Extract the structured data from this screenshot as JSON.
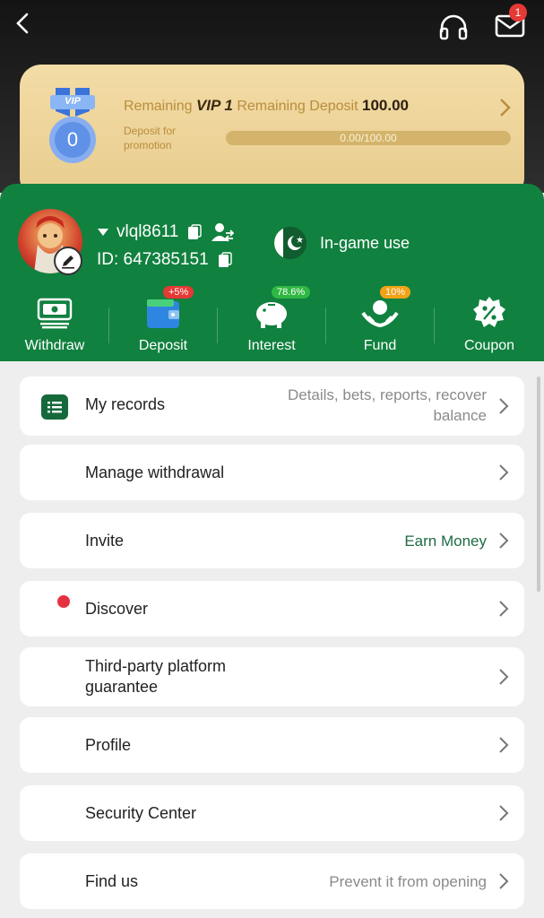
{
  "header": {
    "back_icon": "chevron-left-icon",
    "support_icon": "headset-icon",
    "mail_icon": "envelope-icon",
    "mail_badge": "1"
  },
  "vip": {
    "medal_label": "VIP",
    "medal_level": "0",
    "remaining_label": "Remaining",
    "level": "VIP 1",
    "remaining_deposit_label": "Remaining Deposit",
    "remaining_amount": "100.00",
    "promo_text": "Deposit for promotion",
    "progress_text": "0.00/100.00",
    "progress_fraction": 0.0
  },
  "user": {
    "username": "vlql8611",
    "id_text": "ID: 647385151",
    "status_text": "In-game use"
  },
  "actions": [
    {
      "label": "Withdraw",
      "icon": "cash-icon"
    },
    {
      "label": "Deposit",
      "icon": "wallet-icon",
      "badge": "+5%"
    },
    {
      "label": "Interest",
      "icon": "piggy-bank-icon",
      "badge": "78.6%"
    },
    {
      "label": "Fund",
      "icon": "fund-hands-icon",
      "badge": "10%"
    },
    {
      "label": "Coupon",
      "icon": "percent-badge-icon"
    }
  ],
  "colors": {
    "accent_green": "#11813f",
    "badge_red": "#e53935",
    "badge_green": "#2fb843",
    "badge_orange": "#f2a215",
    "gold": "#e8cc8e"
  },
  "menu": [
    {
      "label": "My records",
      "right": "Details, bets, reports, recover balance"
    },
    {
      "label": "Manage withdrawal",
      "right": ""
    },
    {
      "label": "Invite",
      "right": "Earn Money"
    },
    {
      "label": "Discover",
      "right": ""
    },
    {
      "label": "Third-party platform guarantee",
      "right": ""
    },
    {
      "label": "Profile",
      "right": ""
    },
    {
      "label": "Security Center",
      "right": ""
    },
    {
      "label": "Find us",
      "right": "Prevent it from opening"
    }
  ]
}
